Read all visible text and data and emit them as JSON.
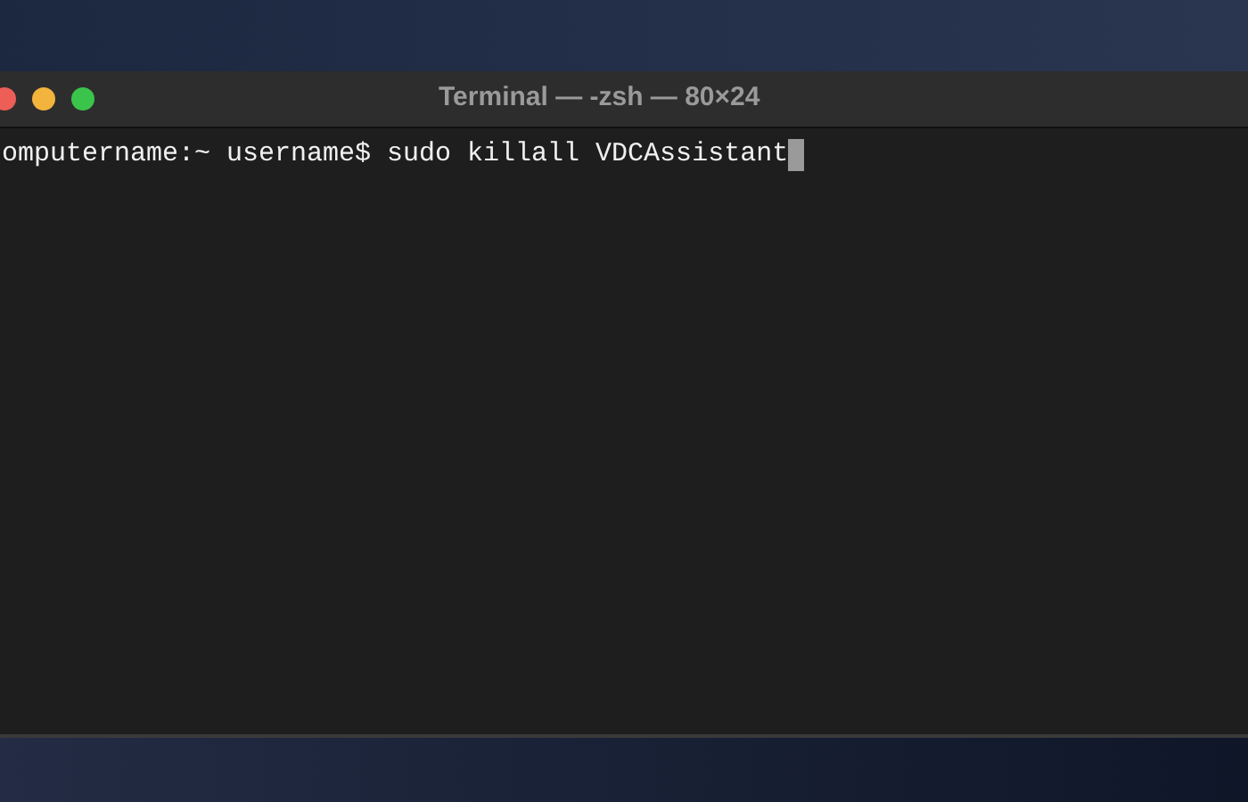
{
  "window": {
    "title": "Terminal — -zsh — 80×24"
  },
  "terminal": {
    "lines": [
      "omputername:~ username$ sudo killall VDCAssistant"
    ],
    "cursor": true
  }
}
